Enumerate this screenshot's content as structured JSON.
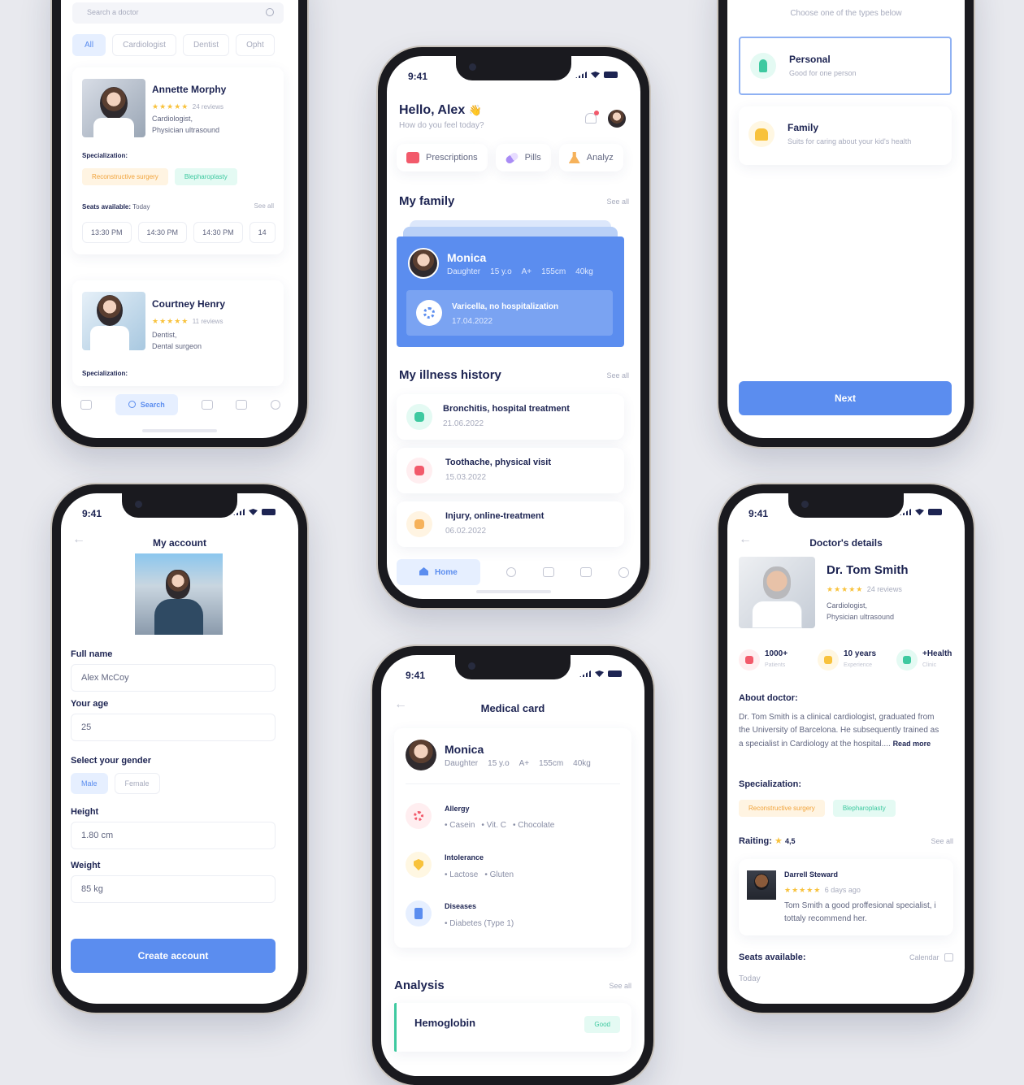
{
  "status_time": "9:41",
  "search": {
    "placeholder": "Search a doctor",
    "chips": [
      "All",
      "Cardiologist",
      "Dentist",
      "Opht"
    ],
    "doctors": [
      {
        "name": "Annette Morphy",
        "reviews": "24 reviews",
        "role": "Cardiologist,",
        "role2": "Physician ultrasound",
        "spec_label": "Specialization:",
        "tags": [
          "Reconstructive surgery",
          "Blepharoplasty"
        ],
        "seats_label": "Seats available:",
        "seats_day": "Today",
        "see_all": "See all",
        "slots": [
          "13:30 PM",
          "14:30 PM",
          "14:30 PM",
          "14"
        ]
      },
      {
        "name": "Courtney Henry",
        "reviews": "11 reviews",
        "role": "Dentist,",
        "role2": "Dental surgeon",
        "spec_label": "Specialization:"
      }
    ],
    "nav_active": "Search"
  },
  "home": {
    "greeting": "Hello, Alex",
    "wave": "👋",
    "subtitle": "How do you feel today?",
    "quick": [
      "Prescriptions",
      "Pills",
      "Analyz"
    ],
    "family_title": "My family",
    "see_all": "See all",
    "member": {
      "name": "Monica",
      "relation": "Daughter",
      "age": "15 y.o",
      "blood": "A+",
      "height": "155cm",
      "weight": "40kg",
      "condition": "Varicella, no hospitalization",
      "date": "17.04.2022"
    },
    "history_title": "My illness history",
    "history": [
      {
        "title": "Bronchitis, hospital treatment",
        "date": "21.06.2022",
        "color": "#3ec9a0",
        "bg": "#e4faf3"
      },
      {
        "title": "Toothache, physical visit",
        "date": "15.03.2022",
        "color": "#f25a6b",
        "bg": "#ffeef0"
      },
      {
        "title": "Injury, online-treatment",
        "date": "06.02.2022",
        "color": "#f6b25b",
        "bg": "#fff4e2"
      }
    ],
    "nav_active": "Home"
  },
  "plan": {
    "hint": "Choose one of the types below",
    "options": [
      {
        "title": "Personal",
        "desc": "Good for one person",
        "color": "#3ec9a0",
        "bg": "#e4faf3"
      },
      {
        "title": "Family",
        "desc": "Suits for caring about your kid's health",
        "color": "#f8c23c",
        "bg": "#fff7e2"
      }
    ],
    "next": "Next"
  },
  "account": {
    "title": "My account",
    "full_name_label": "Full name",
    "full_name": "Alex McCoy",
    "age_label": "Your age",
    "age": "25",
    "gender_label": "Select your gender",
    "genders": [
      "Male",
      "Female"
    ],
    "height_label": "Height",
    "height": "1.80 cm",
    "weight_label": "Weight",
    "weight": "85 kg",
    "create": "Create account"
  },
  "medical": {
    "title": "Medical card",
    "name": "Monica",
    "relation": "Daughter",
    "age": "15 y.o",
    "blood": "A+",
    "height": "155cm",
    "weight": "40kg",
    "allergy_label": "Allergy",
    "allergy": [
      "Casein",
      "Vit. C",
      "Chocolate"
    ],
    "intolerance_label": "Intolerance",
    "intolerance": [
      "Lactose",
      "Gluten"
    ],
    "diseases_label": "Diseases",
    "diseases": [
      "Diabetes (Type 1)"
    ],
    "analysis_title": "Analysis",
    "see_all": "See all",
    "analysis_item": "Hemoglobin",
    "analysis_status": "Good"
  },
  "doctor": {
    "title": "Doctor's details",
    "name": "Dr. Tom Smith",
    "reviews": "24 reviews",
    "role": "Cardiologist,",
    "role2": "Physician ultrasound",
    "stats": [
      {
        "value": "1000+",
        "label": "Patients",
        "color": "#f25a6b",
        "bg": "#ffeef0"
      },
      {
        "value": "10 years",
        "label": "Experience",
        "color": "#f8c23c",
        "bg": "#fff7e2"
      },
      {
        "value": "+Health",
        "label": "Clinic",
        "color": "#3ec9a0",
        "bg": "#e4faf3"
      }
    ],
    "about_title": "About doctor:",
    "about": "Dr. Tom Smith is a clinical cardiologist, graduated from the University of Barcelona. He subsequently trained as a specialist in Cardiology at the hospital....",
    "read_more": "Read more",
    "spec_title": "Specialization:",
    "tags": [
      "Reconstructive surgery",
      "Blepharoplasty"
    ],
    "rating_label": "Raiting:",
    "rating": "4,5",
    "see_all": "See all",
    "review": {
      "author": "Darrell Steward",
      "ago": "6 days ago",
      "text": "Tom Smith a good proffesional specialist, i tottaly recommend her."
    },
    "seats_label": "Seats available:",
    "calendar": "Calendar",
    "today": "Today"
  }
}
